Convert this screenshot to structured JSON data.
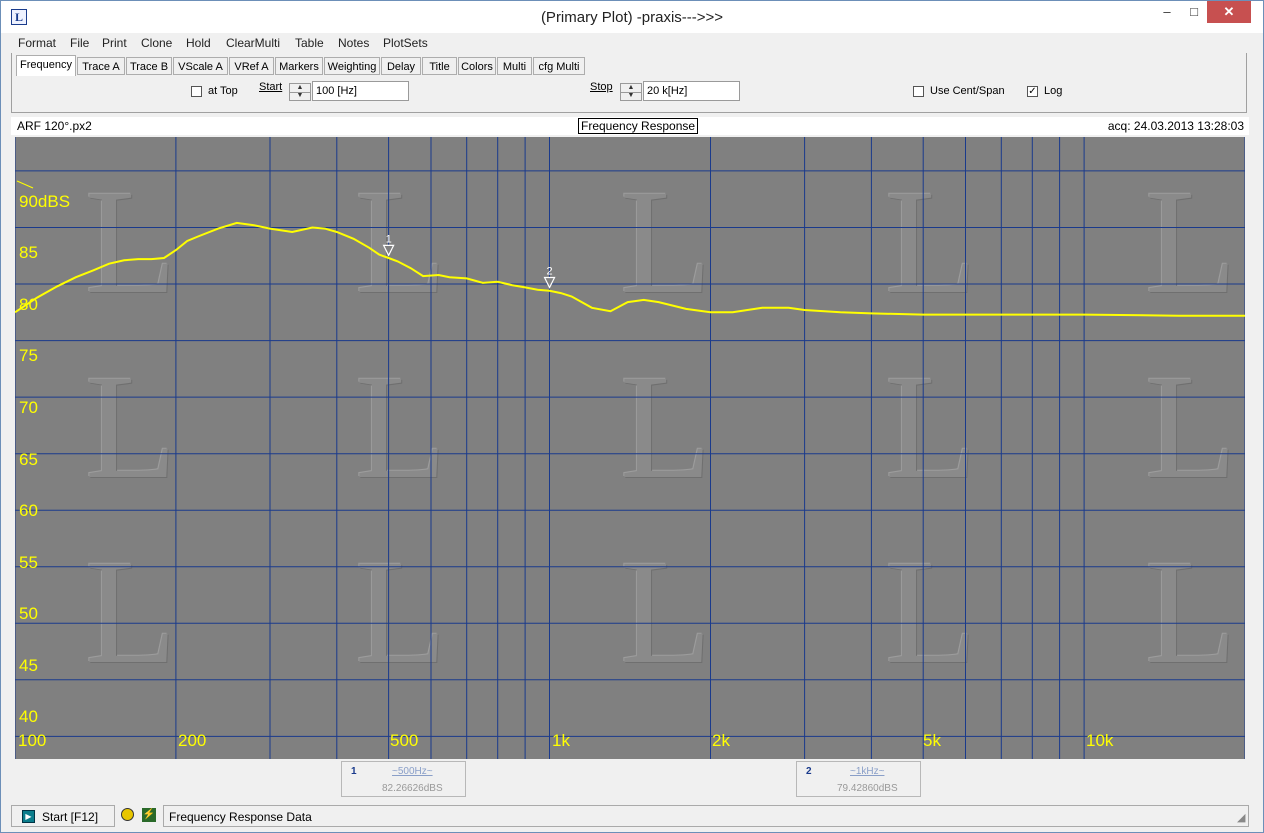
{
  "window": {
    "title": "(Primary Plot) -praxis--->>>",
    "app_icon": "L",
    "minimize": "–",
    "maximize": "□",
    "close": "✕"
  },
  "menu": [
    "Format",
    "File",
    "Print",
    "Clone",
    "Hold",
    "ClearMulti",
    "Table",
    "Notes",
    "PlotSets"
  ],
  "tabs": [
    "Frequency",
    "Trace A",
    "Trace B",
    "VScale A",
    "VRef A",
    "Markers",
    "Weighting",
    "Delay",
    "Title",
    "Colors",
    "Multi",
    "cfg Multi"
  ],
  "controls": {
    "at_top": {
      "label": "at Top",
      "checked": false
    },
    "start": {
      "label": "Start",
      "value": "100 [Hz]"
    },
    "stop": {
      "label": "Stop",
      "value": "20 k[Hz]"
    },
    "use_cent_span": {
      "label": "Use Cent/Span",
      "checked": false
    },
    "log": {
      "label": "Log",
      "checked": true
    }
  },
  "info": {
    "file": "ARF 120°.px2",
    "plot_title": "Frequency Response",
    "acq": "acq: 24.03.2013 13:28:03"
  },
  "colors": {
    "plot_bg": "#808080",
    "grid": "#1a3a8c",
    "trace": "#ffff00"
  },
  "chart_data": {
    "type": "line",
    "title": "Frequency Response",
    "x_scale": "log",
    "xlim": [
      100,
      20000
    ],
    "ylim": [
      38,
      93
    ],
    "grid": true,
    "x_tick_labels": [
      "100",
      "200",
      "500",
      "1k",
      "2k",
      "5k",
      "10k"
    ],
    "y_tick_labels": [
      "90dBS",
      "85",
      "80",
      "75",
      "70",
      "65",
      "60",
      "55",
      "50",
      "45",
      "40"
    ],
    "series": [
      {
        "x": [
          100,
          110,
          120,
          130,
          140,
          150,
          160,
          170,
          180,
          190,
          200,
          210,
          220,
          240,
          260,
          280,
          300,
          330,
          360,
          380,
          400,
          430,
          460,
          480,
          500,
          520,
          550,
          580,
          620,
          650,
          700,
          750,
          800,
          850,
          900,
          950,
          1000,
          1050,
          1100,
          1200,
          1300,
          1400,
          1500,
          1600,
          1800,
          2000,
          2200,
          2500,
          2800,
          3000,
          3500,
          4000,
          5000,
          6000,
          8000,
          10000,
          15000,
          20000
        ],
        "y": [
          77.5,
          78.8,
          79.8,
          80.6,
          81.2,
          81.8,
          82.1,
          82.2,
          82.2,
          82.3,
          83.0,
          83.8,
          84.2,
          84.9,
          85.4,
          85.2,
          84.9,
          84.6,
          85.0,
          84.9,
          84.6,
          84.0,
          83.2,
          82.6,
          82.3,
          82.0,
          81.4,
          80.7,
          80.8,
          80.6,
          80.5,
          80.1,
          80.2,
          79.9,
          79.7,
          79.5,
          79.4,
          79.2,
          78.9,
          77.9,
          77.6,
          78.4,
          78.6,
          78.4,
          77.8,
          77.5,
          77.5,
          77.9,
          77.9,
          77.7,
          77.5,
          77.4,
          77.3,
          77.3,
          77.3,
          77.3,
          77.2,
          77.2
        ]
      }
    ],
    "markers": [
      {
        "label": "1",
        "x": 500,
        "y": 82.26626
      },
      {
        "label": "2",
        "x": 1000,
        "y": 79.4286
      }
    ]
  },
  "marker_readouts": [
    {
      "index": "1",
      "freq": "~500Hz~",
      "value": "82.26626dBS"
    },
    {
      "index": "2",
      "freq": "~1kHz~",
      "value": "79.42860dBS"
    }
  ],
  "status": {
    "start_label": "Start [F12]",
    "text": "Frequency Response Data"
  }
}
